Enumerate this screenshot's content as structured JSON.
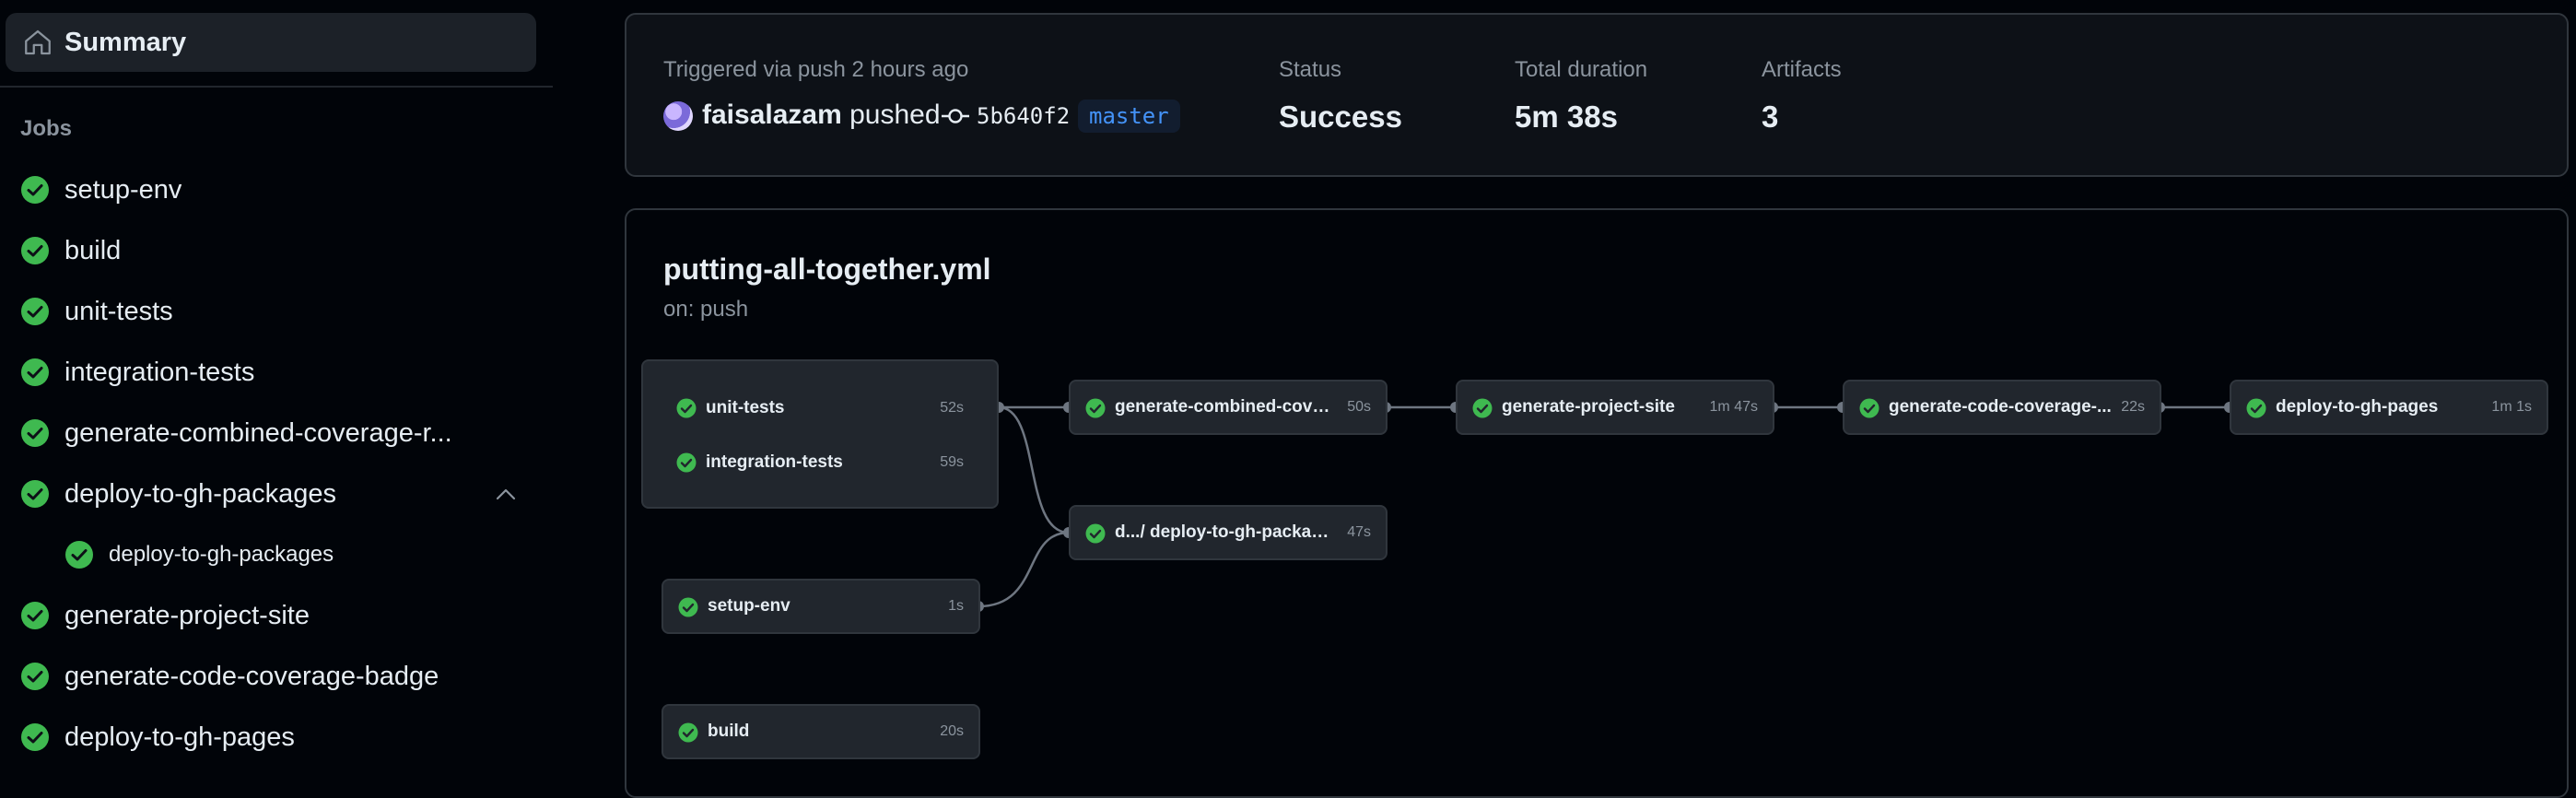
{
  "sidebar": {
    "summary_label": "Summary",
    "jobs_heading": "Jobs",
    "jobs": [
      {
        "label": "setup-env"
      },
      {
        "label": "build"
      },
      {
        "label": "unit-tests"
      },
      {
        "label": "integration-tests"
      },
      {
        "label": "generate-combined-coverage-r..."
      },
      {
        "label": "deploy-to-gh-packages",
        "expanded": true
      },
      {
        "label": "deploy-to-gh-packages",
        "sub": true
      },
      {
        "label": "generate-project-site"
      },
      {
        "label": "generate-code-coverage-badge"
      },
      {
        "label": "deploy-to-gh-pages"
      }
    ]
  },
  "summary": {
    "trigger_text": "Triggered via push 2 hours ago",
    "actor": "faisalazam",
    "action": "pushed",
    "commit_sha": "5b640f2",
    "branch": "master",
    "status_label": "Status",
    "status_value": "Success",
    "duration_label": "Total duration",
    "duration_value": "5m 38s",
    "artifacts_label": "Artifacts",
    "artifacts_value": "3"
  },
  "workflow": {
    "file": "putting-all-together.yml",
    "trigger": "on: push",
    "nodes": {
      "unit_tests": {
        "label": "unit-tests",
        "duration": "52s"
      },
      "integration_tests": {
        "label": "integration-tests",
        "duration": "59s"
      },
      "setup_env": {
        "label": "setup-env",
        "duration": "1s"
      },
      "build": {
        "label": "build",
        "duration": "20s"
      },
      "gen_combined": {
        "label": "generate-combined-cove...",
        "duration": "50s"
      },
      "deploy_packages": {
        "label": "d.../ deploy-to-gh-packag...",
        "duration": "47s"
      },
      "gen_site": {
        "label": "generate-project-site",
        "duration": "1m 47s"
      },
      "gen_badge": {
        "label": "generate-code-coverage-...",
        "duration": "22s"
      },
      "deploy_pages": {
        "label": "deploy-to-gh-pages",
        "duration": "1m 1s"
      }
    }
  },
  "colors": {
    "success": "#3fb950",
    "branch_text": "#4493f8",
    "muted": "#8b949e"
  },
  "icons": {
    "summary": "home-icon",
    "job_status": "check-circle-icon",
    "commit": "git-commit-icon",
    "expand": "chevron-up-icon"
  }
}
